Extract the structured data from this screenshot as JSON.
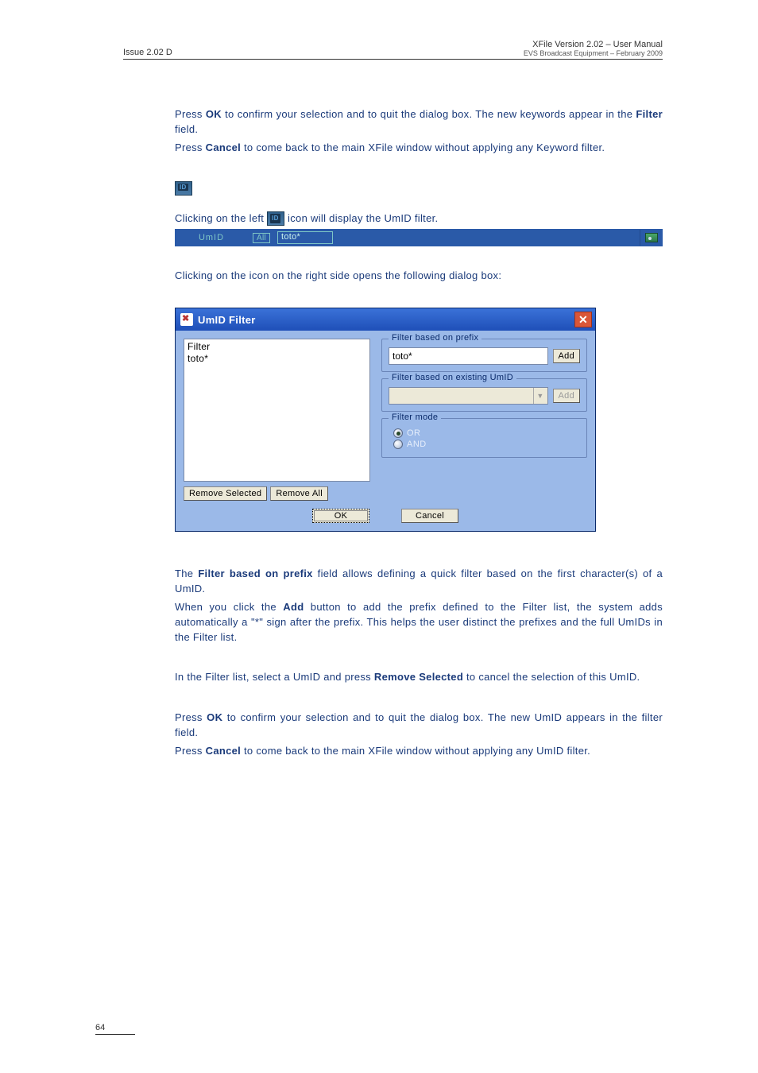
{
  "header": {
    "left": "Issue 2.02 D",
    "right_title": "XFile Version 2.02 – User Manual",
    "right_sub": "EVS Broadcast Equipment – February 2009"
  },
  "intro": {
    "p1a": "Press ",
    "p1_ok": "OK",
    "p1b": " to confirm your selection and to quit the dialog box. The new keywords appear in the ",
    "p1_filter": "Filter",
    "p1c": " field.",
    "p2a": "Press ",
    "p2_cancel": "Cancel",
    "p2b": " to come back to the main XFile window without applying any Keyword filter."
  },
  "umid_section": {
    "line1a": "Clicking on the left ",
    "line1b": " icon will display the UmID filter.",
    "bar_label": "UmID",
    "bar_all": "All",
    "bar_value": "toto*",
    "line2": "Clicking on the icon on the right side opens the following dialog box:"
  },
  "dialog": {
    "title": "UmID Filter",
    "list_header": "Filter",
    "list_items": [
      "toto*"
    ],
    "remove_selected": "Remove Selected",
    "remove_all": "Remove All",
    "group_prefix": "Filter based on prefix",
    "prefix_value": "toto*",
    "add": "Add",
    "group_umid": "Filter based on existing UmID",
    "add2": "Add",
    "group_mode": "Filter mode",
    "mode_or": "OR",
    "mode_and": "AND",
    "ok": "OK",
    "cancel": "Cancel"
  },
  "after": {
    "p1a": "The ",
    "p1_bold": "Filter based on prefix",
    "p1b": " field allows defining a quick filter based on the first character(s) of a UmID.",
    "p2a": "When you click the ",
    "p2_add": "Add",
    "p2b": " button to add the prefix defined to the Filter list, the system adds automatically a \"*\" sign after the prefix. This helps the user distinct the prefixes and the full UmIDs in the Filter list.",
    "p3a": "In the Filter list, select a UmID and press ",
    "p3_rs": "Remove Selected",
    "p3b": " to cancel the selection of this UmID.",
    "p4a": "Press ",
    "p4_ok": "OK",
    "p4b": " to confirm your selection and to quit the dialog box. The new UmID appears in the filter field.",
    "p5a": "Press ",
    "p5_cancel": "Cancel",
    "p5b": " to come back to the main XFile window without applying any UmID filter."
  },
  "footer": {
    "page": "64"
  }
}
